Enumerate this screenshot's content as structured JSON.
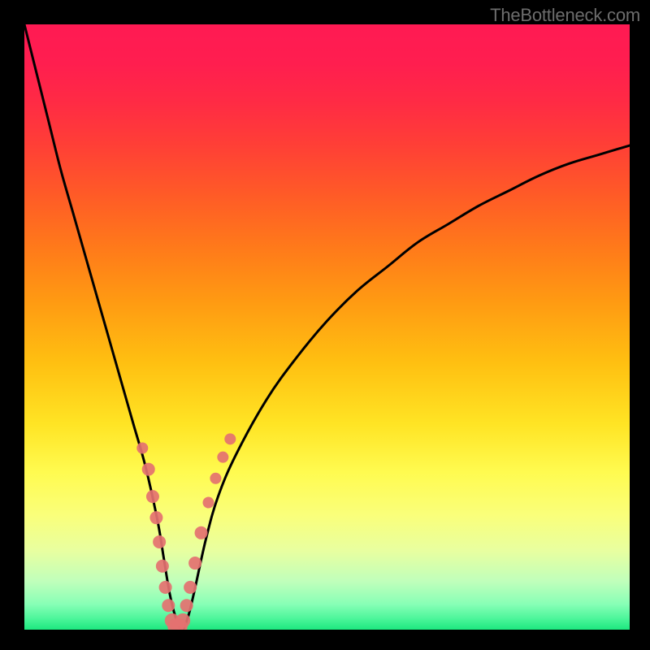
{
  "watermark": "TheBottleneck.com",
  "colors": {
    "bg_black": "#000000",
    "gradient_stops": [
      {
        "pos": 0.0,
        "color": "#ff1a53"
      },
      {
        "pos": 0.065,
        "color": "#ff1e4f"
      },
      {
        "pos": 0.13,
        "color": "#ff2b44"
      },
      {
        "pos": 0.2,
        "color": "#ff3f36"
      },
      {
        "pos": 0.28,
        "color": "#ff5a27"
      },
      {
        "pos": 0.37,
        "color": "#ff7a1a"
      },
      {
        "pos": 0.46,
        "color": "#ff9b12"
      },
      {
        "pos": 0.56,
        "color": "#ffc011"
      },
      {
        "pos": 0.66,
        "color": "#ffe424"
      },
      {
        "pos": 0.74,
        "color": "#fffb50"
      },
      {
        "pos": 0.81,
        "color": "#faff7a"
      },
      {
        "pos": 0.87,
        "color": "#e8ffa0"
      },
      {
        "pos": 0.92,
        "color": "#c0ffbb"
      },
      {
        "pos": 0.958,
        "color": "#87ffb6"
      },
      {
        "pos": 0.982,
        "color": "#4bf59a"
      },
      {
        "pos": 1.0,
        "color": "#1de87f"
      }
    ],
    "curve": "#000000",
    "dot_fill": "#e47170"
  },
  "chart_data": {
    "type": "line",
    "title": "",
    "xlabel": "",
    "ylabel": "",
    "xlim": [
      0,
      100
    ],
    "ylim": [
      0,
      100
    ],
    "grid": false,
    "series": [
      {
        "name": "bottleneck-curve",
        "x": [
          0,
          2,
          4,
          6,
          8,
          10,
          12,
          14,
          16,
          18,
          20,
          22,
          23,
          24,
          25,
          26,
          27,
          28,
          30,
          32,
          35,
          40,
          45,
          50,
          55,
          60,
          65,
          70,
          75,
          80,
          85,
          90,
          95,
          100
        ],
        "y": [
          100,
          92,
          84,
          76,
          69,
          62,
          55,
          48,
          41,
          34,
          27,
          18,
          12,
          6,
          2,
          0,
          2,
          6,
          15,
          22,
          29,
          38,
          45,
          51,
          56,
          60,
          64,
          67,
          70,
          72.5,
          75,
          77,
          78.5,
          80
        ]
      }
    ],
    "scatter_overlay": {
      "name": "sample-points",
      "x": [
        19.5,
        20.5,
        21.2,
        21.8,
        22.3,
        22.8,
        23.3,
        23.8,
        24.4,
        25.0,
        25.6,
        26.2,
        26.8,
        27.4,
        28.2,
        29.2,
        30.4,
        31.6,
        32.8,
        34.0
      ],
      "y": [
        30.0,
        26.5,
        22.0,
        18.5,
        14.5,
        10.5,
        7.0,
        4.0,
        1.5,
        0.5,
        0.5,
        1.5,
        4.0,
        7.0,
        11.0,
        16.0,
        21.0,
        25.0,
        28.5,
        31.5
      ],
      "r": [
        7,
        8,
        8,
        8,
        8,
        8,
        8,
        8,
        9,
        10,
        10,
        9,
        8,
        8,
        8,
        8,
        7,
        7,
        7,
        7
      ]
    },
    "legend": false
  }
}
